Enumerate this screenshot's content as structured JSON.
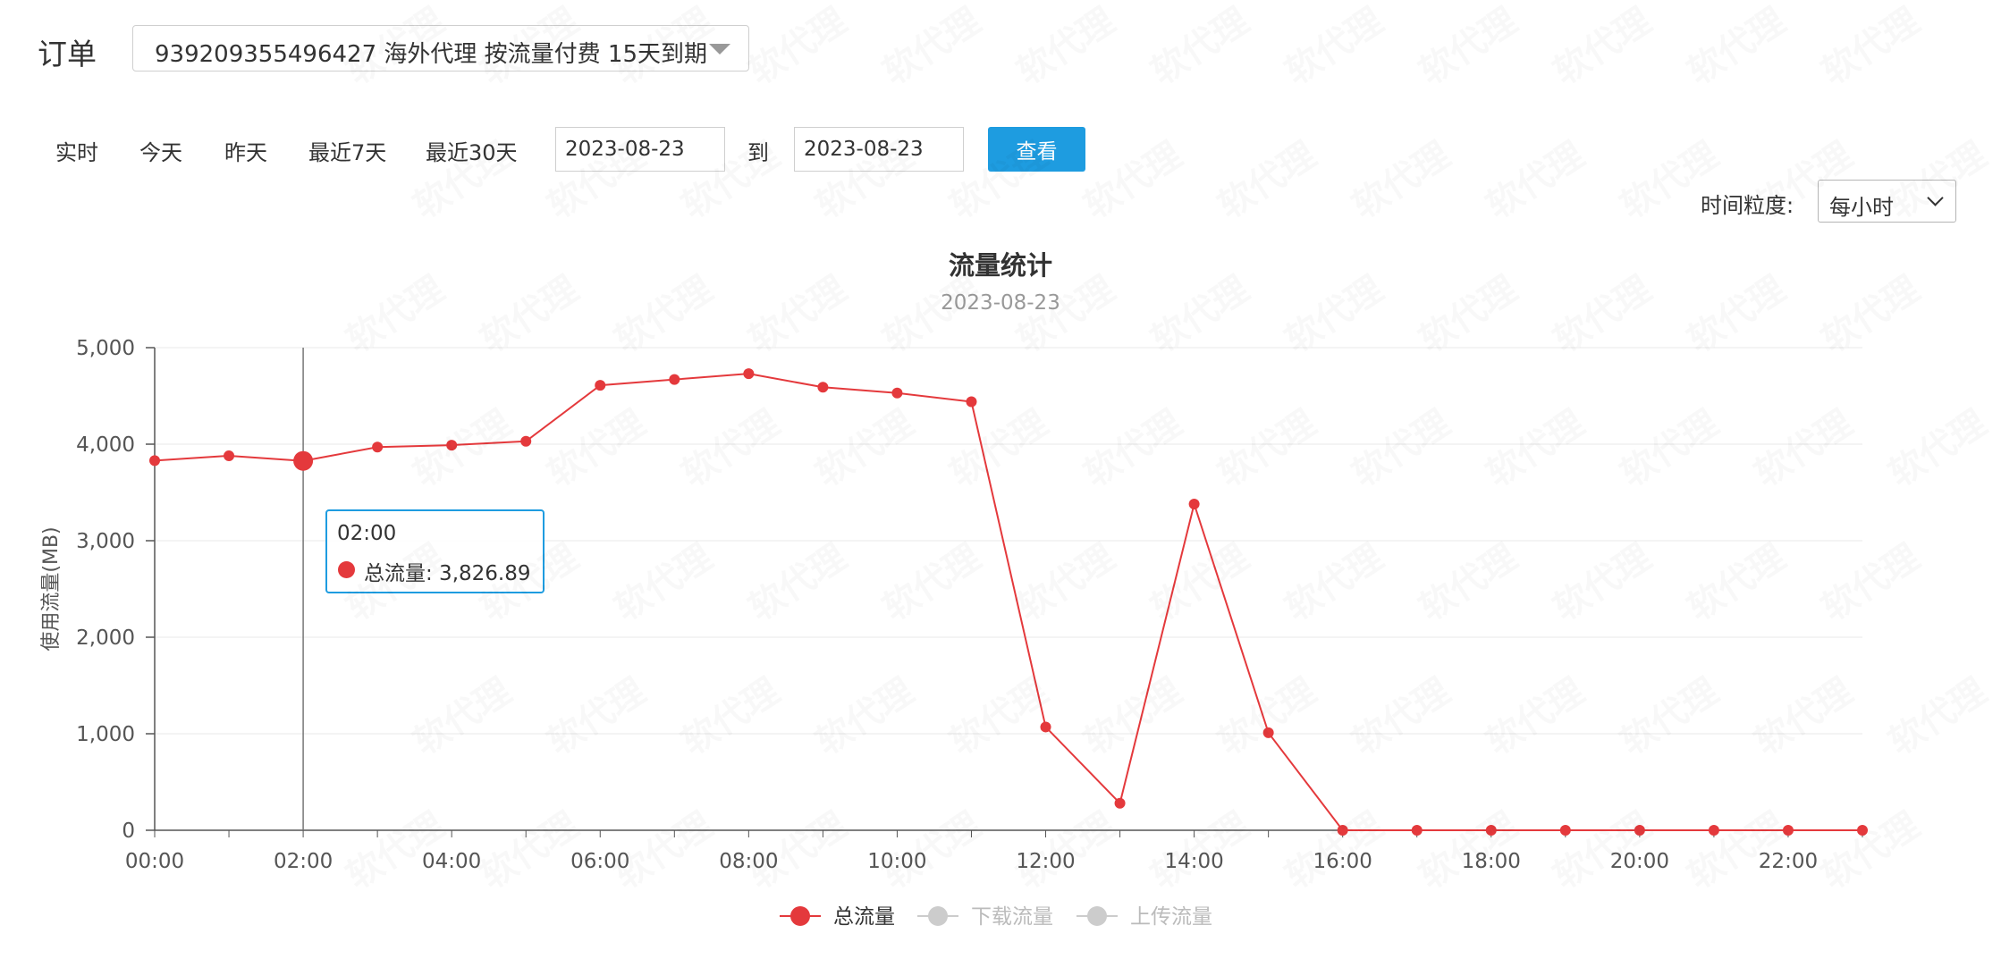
{
  "order": {
    "label": "订单",
    "selected": "939209355496427  海外代理  按流量付费  15天到期"
  },
  "ranges": [
    "实时",
    "今天",
    "昨天",
    "最近7天",
    "最近30天"
  ],
  "date_from": "2023-08-23",
  "date_to": "2023-08-23",
  "to_label": "到",
  "view_button": "查看",
  "granularity": {
    "label": "时间粒度:",
    "value": "每小时"
  },
  "watermark_text": "软代理",
  "colors": {
    "series": "#e4393c",
    "accent": "#1e9ce0",
    "disabled": "#bbbbbb"
  },
  "tooltip": {
    "time": "02:00",
    "label": "总流量: 3,826.89"
  },
  "chart_data": {
    "type": "line",
    "title": "流量统计",
    "subtitle": "2023-08-23",
    "ylabel": "使用流量(MB)",
    "xlabel": "",
    "ylim": [
      0,
      5000
    ],
    "yticks": [
      "0",
      "1,000",
      "2,000",
      "3,000",
      "4,000",
      "5,000"
    ],
    "x": [
      "00:00",
      "01:00",
      "02:00",
      "03:00",
      "04:00",
      "05:00",
      "06:00",
      "07:00",
      "08:00",
      "09:00",
      "10:00",
      "11:00",
      "12:00",
      "13:00",
      "14:00",
      "15:00",
      "16:00",
      "17:00",
      "18:00",
      "19:00",
      "20:00",
      "21:00",
      "22:00",
      "23:00"
    ],
    "xtick_labels": [
      "00:00",
      "02:00",
      "04:00",
      "06:00",
      "08:00",
      "10:00",
      "12:00",
      "14:00",
      "16:00",
      "18:00",
      "20:00",
      "22:00"
    ],
    "series": [
      {
        "name": "总流量",
        "values": [
          3830,
          3880,
          3826.89,
          3970,
          3990,
          4030,
          4610,
          4670,
          4730,
          4590,
          4530,
          4440,
          1070,
          280,
          3380,
          1010,
          0,
          0,
          0,
          0,
          0,
          0,
          0,
          0
        ],
        "active": true
      },
      {
        "name": "下载流量",
        "values": [],
        "active": false
      },
      {
        "name": "上传流量",
        "values": [],
        "active": false
      }
    ],
    "highlight_x": "02:00",
    "grid": true,
    "legend": "bottom-center"
  }
}
